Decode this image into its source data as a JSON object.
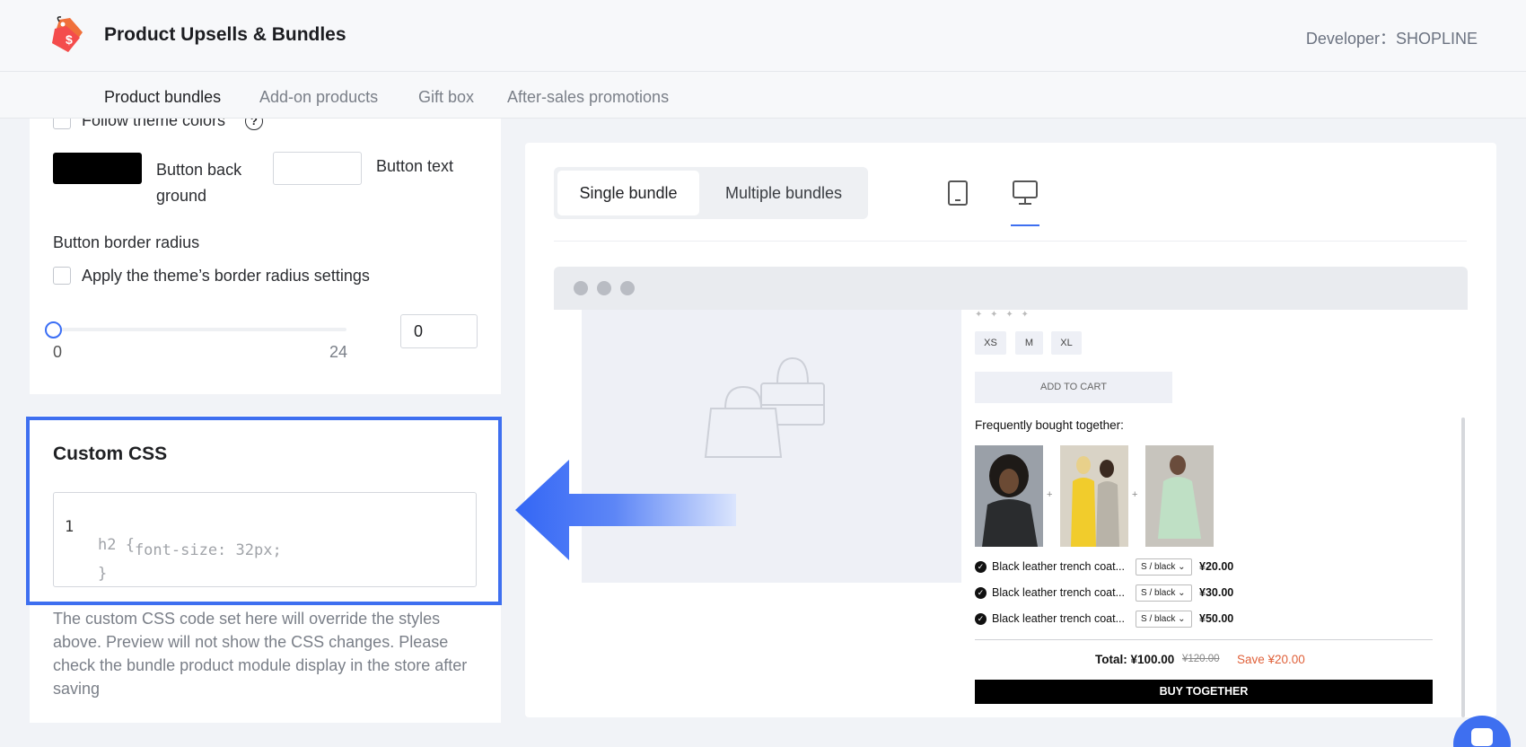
{
  "header": {
    "app_title": "Product Upsells & Bundles",
    "developer": "Developer：SHOPLINE",
    "logo_icon": "price-tag-bag-icon",
    "logo_symbol": "$"
  },
  "nav": {
    "tabs": [
      {
        "label": "Product bundles",
        "active": true
      },
      {
        "label": "Add-on products",
        "active": false
      },
      {
        "label": "Gift box",
        "active": false
      },
      {
        "label": "After-sales promotions",
        "active": false
      }
    ]
  },
  "settings": {
    "follow_theme_colors": "Follow theme colors",
    "button_background_label": "Button back\nground",
    "button_background_color": "#000000",
    "button_text_label": "Button text",
    "button_text_color": "#ffffff",
    "border_radius_title": "Button border radius",
    "apply_theme_radius": "Apply the theme’s border radius settings",
    "slider_min": "0",
    "slider_max": "24",
    "slider_value": "0"
  },
  "custom_css": {
    "title": "Custom CSS",
    "line_number": "1",
    "code_lines": [
      "h2 {",
      "    font-size: 32px;",
      "}"
    ],
    "note": "The custom CSS code set here will override the styles above. Preview will not show the CSS changes. Please check the bundle product module display in the store after saving"
  },
  "preview": {
    "tabs": [
      "Single bundle",
      "Multiple bundles"
    ],
    "active_tab": "Single bundle",
    "device_icons": [
      "mobile-icon",
      "desktop-icon"
    ],
    "active_device": "desktop-icon",
    "sizes": [
      "XS",
      "M",
      "XL"
    ],
    "add_to_cart": "ADD TO CART",
    "fbt_title": "Frequently bought together:",
    "products": [
      {
        "name": "Black leather trench coat...",
        "variant": "S / black",
        "price": "¥20.00"
      },
      {
        "name": "Black leather trench coat...",
        "variant": "S / black",
        "price": "¥30.00"
      },
      {
        "name": "Black leather trench coat...",
        "variant": "S / black",
        "price": "¥50.00"
      }
    ],
    "total": "Total: ¥100.00",
    "original_total": "¥120.00",
    "save": "Save ¥20.00",
    "buy_button": "BUY TOGETHER"
  },
  "colors": {
    "accent": "#3e6ff0",
    "save_red": "#e0613a",
    "logo_orange": "#f0703a"
  }
}
